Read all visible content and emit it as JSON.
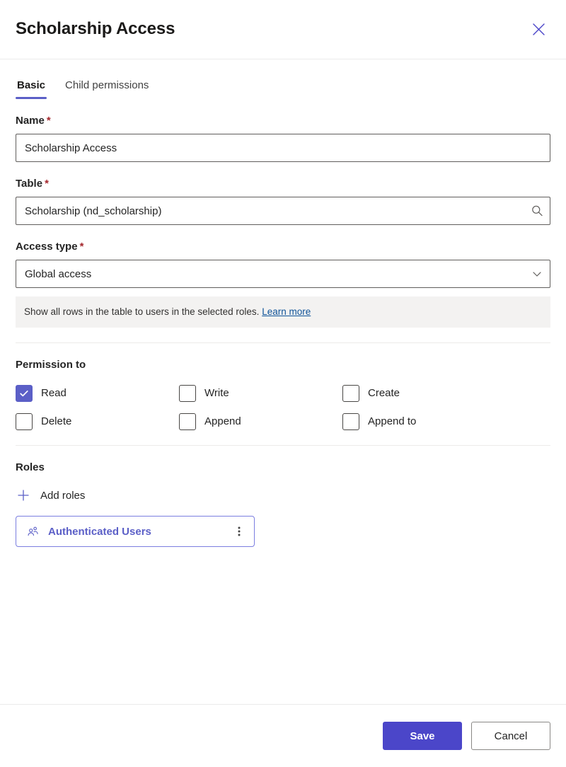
{
  "header": {
    "title": "Scholarship Access",
    "close_icon": "close-icon"
  },
  "tabs": [
    {
      "label": "Basic",
      "active": true
    },
    {
      "label": "Child permissions",
      "active": false
    }
  ],
  "form": {
    "name": {
      "label": "Name",
      "required_marker": "*",
      "value": "Scholarship Access",
      "placeholder": ""
    },
    "table": {
      "label": "Table",
      "required_marker": "*",
      "value": "Scholarship (nd_scholarship)",
      "placeholder": "",
      "icon": "search-icon"
    },
    "access_type": {
      "label": "Access type",
      "required_marker": "*",
      "selected": "Global access",
      "icon": "chevron-down-icon",
      "hint_text": "Show all rows in the table to users in the selected roles.",
      "hint_link": "Learn more"
    }
  },
  "permissions": {
    "title": "Permission to",
    "items": [
      {
        "label": "Read",
        "checked": true
      },
      {
        "label": "Write",
        "checked": false
      },
      {
        "label": "Create",
        "checked": false
      },
      {
        "label": "Delete",
        "checked": false
      },
      {
        "label": "Append",
        "checked": false
      },
      {
        "label": "Append to",
        "checked": false
      }
    ]
  },
  "roles": {
    "title": "Roles",
    "add_label": "Add roles",
    "add_icon": "plus-icon",
    "chips": [
      {
        "name": "Authenticated Users",
        "icon": "people-icon",
        "more_icon": "more-vertical-icon"
      }
    ]
  },
  "footer": {
    "save_label": "Save",
    "cancel_label": "Cancel"
  },
  "colors": {
    "accent": "#5b5fc7",
    "primary_button": "#4b46c9",
    "required": "#a4262c",
    "link": "#0f5499",
    "hint_bg": "#f3f2f1"
  }
}
